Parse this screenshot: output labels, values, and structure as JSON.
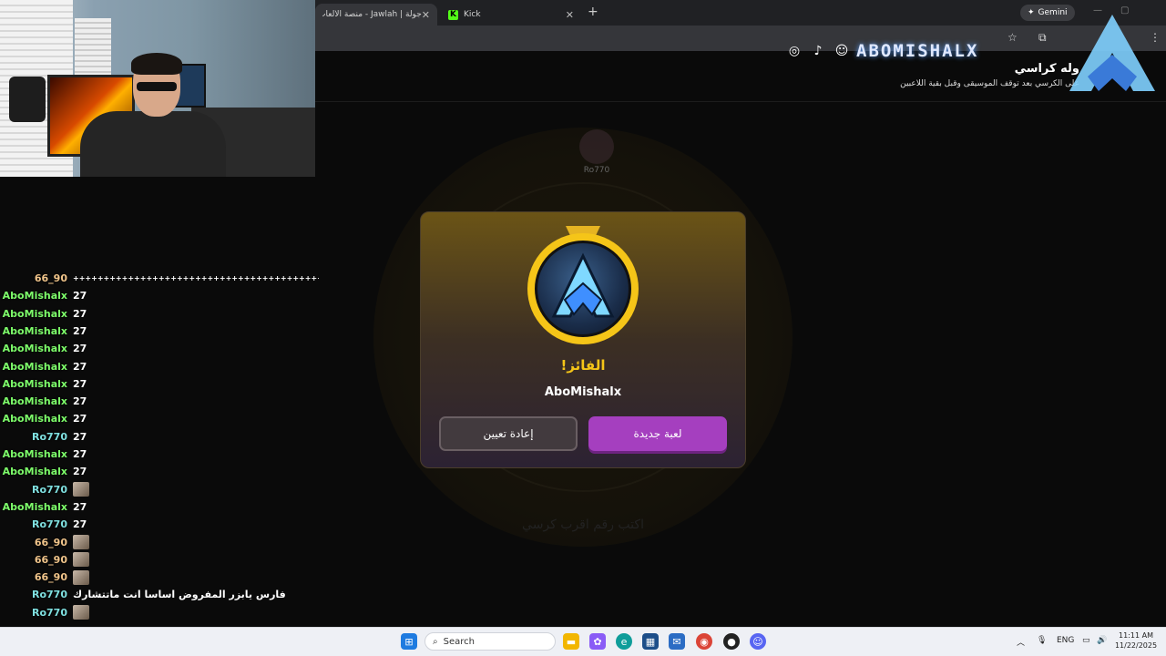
{
  "browser": {
    "tabs": [
      {
        "label": "جولة | Jawlah - منصة الألعاب الت",
        "close": "✕"
      },
      {
        "label": "Kick",
        "close": "✕"
      }
    ],
    "new_tab": "+",
    "gemini_label": "Gemini"
  },
  "game": {
    "title": "وله كراسي",
    "subtitle": "على الكرسي بعد توقف الموسيقى وقبل بقية اللاعبين",
    "seat_player": "Ro770",
    "faded_hint": "اكتب رقم اقرب كرسي"
  },
  "modal": {
    "heading": "الفائز!",
    "winner": "AboMishalx",
    "new_game_label": "لعبة جديدة",
    "reset_label": "إعادة تعيين"
  },
  "overlay": {
    "brand": "ABOMISHALX"
  },
  "chat": {
    "messages": [
      {
        "user": "66_90",
        "text": "+++++++++++++++++++++++++++++++++++++++++++++++++++",
        "color": "#f0c48a"
      },
      {
        "user": "AboMishalx",
        "text": "27",
        "color": "#7dfc6a"
      },
      {
        "user": "AboMishalx",
        "text": "27",
        "color": "#7dfc6a"
      },
      {
        "user": "AboMishalx",
        "text": "27",
        "color": "#7dfc6a"
      },
      {
        "user": "AboMishalx",
        "text": "27",
        "color": "#7dfc6a"
      },
      {
        "user": "AboMishalx",
        "text": "27",
        "color": "#7dfc6a"
      },
      {
        "user": "AboMishalx",
        "text": "27",
        "color": "#7dfc6a"
      },
      {
        "user": "AboMishalx",
        "text": "27",
        "color": "#7dfc6a"
      },
      {
        "user": "AboMishalx",
        "text": "27",
        "color": "#7dfc6a"
      },
      {
        "user": "Ro770",
        "text": "27",
        "color": "#7fe0e0"
      },
      {
        "user": "AboMishalx",
        "text": "27",
        "color": "#7dfc6a"
      },
      {
        "user": "AboMishalx",
        "text": "27",
        "color": "#7dfc6a"
      },
      {
        "user": "Ro770",
        "text": "",
        "color": "#7fe0e0",
        "emote": true
      },
      {
        "user": "AboMishalx",
        "text": "27",
        "color": "#7dfc6a"
      },
      {
        "user": "Ro770",
        "text": "27",
        "color": "#7fe0e0"
      },
      {
        "user": "66_90",
        "text": "",
        "color": "#f0c48a",
        "emote": true
      },
      {
        "user": "66_90",
        "text": "",
        "color": "#f0c48a",
        "emote": true
      },
      {
        "user": "66_90",
        "text": "",
        "color": "#f0c48a",
        "emote": true
      },
      {
        "user": "Ro770",
        "text": "فارس يابزر المفروض اساسا انت ماتتشارك",
        "color": "#7fe0e0"
      },
      {
        "user": "Ro770",
        "text": "",
        "color": "#7fe0e0",
        "emote": true
      }
    ]
  },
  "taskbar": {
    "search_placeholder": "Search",
    "language": "ENG",
    "time": "11:11 AM",
    "date": "11/22/2025"
  }
}
